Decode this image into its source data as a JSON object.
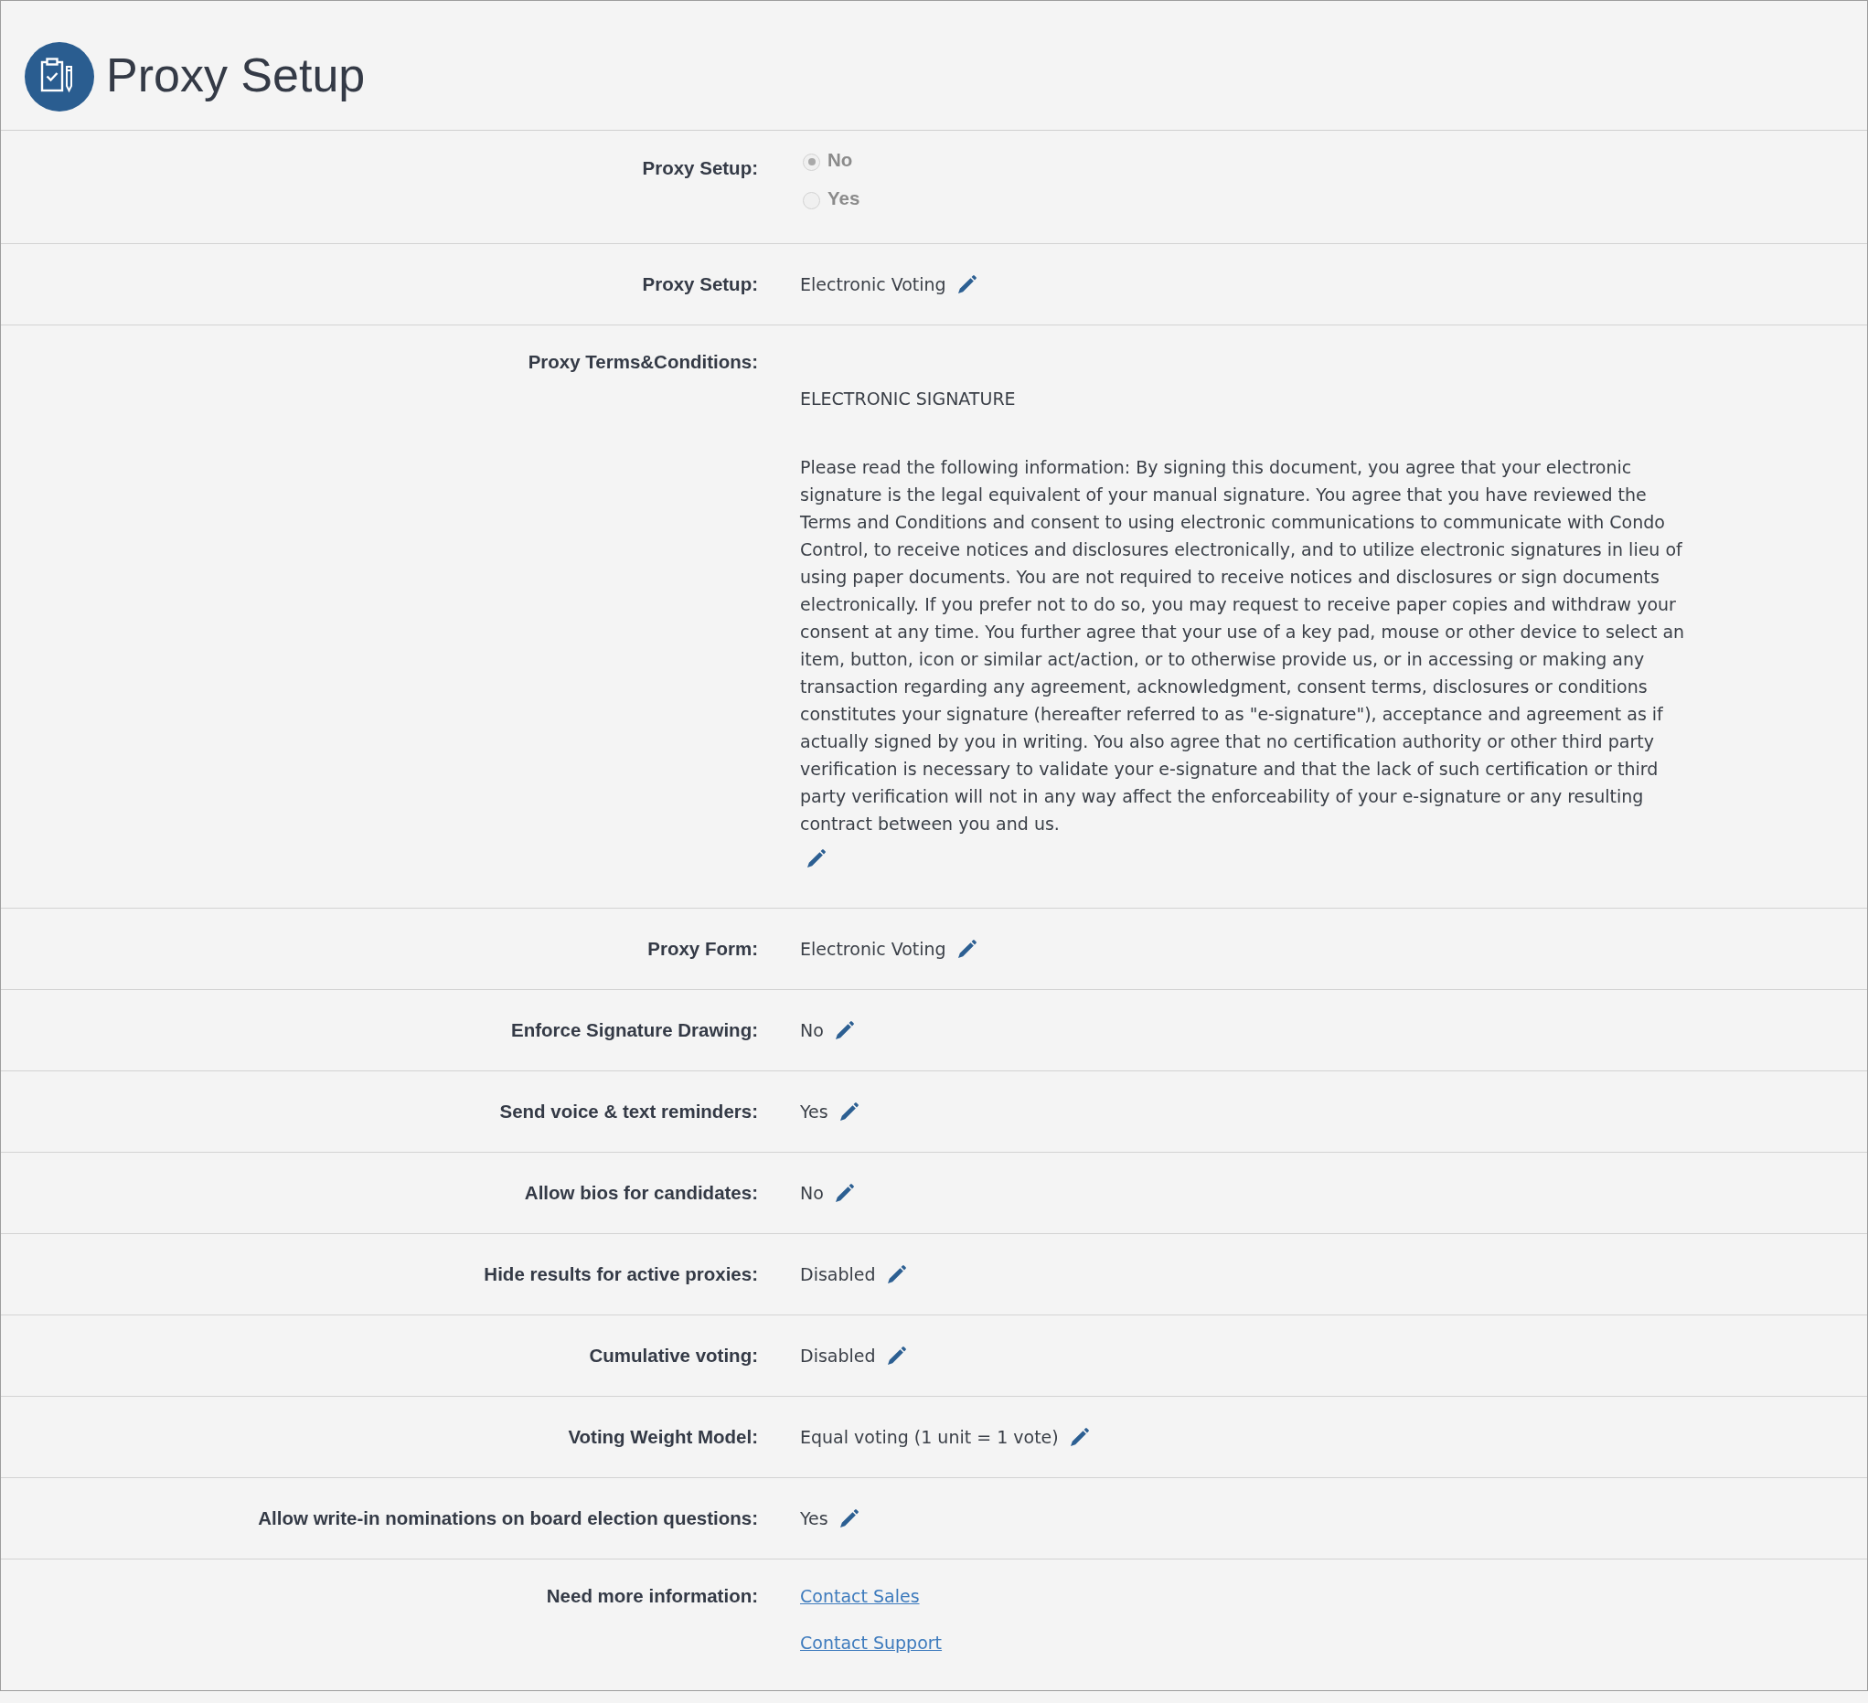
{
  "header": {
    "title": "Proxy Setup"
  },
  "rows": [
    {
      "kind": "radio",
      "label": "Proxy Setup:",
      "options": [
        {
          "label": "No",
          "selected": true,
          "disabled": true
        },
        {
          "label": "Yes",
          "selected": false,
          "disabled": true
        }
      ]
    },
    {
      "kind": "value",
      "label": "Proxy Setup:",
      "value": "Electronic Voting"
    },
    {
      "kind": "terms",
      "label": "Proxy Terms&Conditions:",
      "heading": "ELECTRONIC SIGNATURE",
      "body": "Please read the following information: By signing this document, you agree that your electronic signature is the legal equivalent of your manual signature. You agree that you have reviewed the Terms and Conditions and consent to using electronic communications to communicate with Condo Control, to receive notices and disclosures electronically, and to utilize electronic signatures in lieu of using paper documents. You are not required to receive notices and disclosures or sign documents electronically. If you prefer not to do so, you may request to receive paper copies and withdraw your consent at any time. You further agree that your use of a key pad, mouse or other device to select an item, button, icon or similar act/action, or to otherwise provide us, or in accessing or making any transaction regarding any agreement, acknowledgment, consent terms, disclosures or conditions constitutes your signature (hereafter referred to as \"e-signature\"), acceptance and agreement as if actually signed by you in writing. You also agree that no certification authority or other third party verification is necessary to validate your e-signature and that the lack of such certification or third party verification will not in any way affect the enforceability of your e-signature or any resulting contract between you and us."
    },
    {
      "kind": "value",
      "label": "Proxy Form:",
      "value": "Electronic Voting"
    },
    {
      "kind": "value",
      "label": "Enforce Signature Drawing:",
      "value": "No"
    },
    {
      "kind": "value",
      "label": "Send voice & text reminders:",
      "value": "Yes"
    },
    {
      "kind": "value",
      "label": "Allow bios for candidates:",
      "value": "No"
    },
    {
      "kind": "value",
      "label": "Hide results for active proxies:",
      "value": "Disabled"
    },
    {
      "kind": "value",
      "label": "Cumulative voting:",
      "value": "Disabled"
    },
    {
      "kind": "value",
      "label": "Voting Weight Model:",
      "value": "Equal voting (1 unit = 1 vote)"
    },
    {
      "kind": "value",
      "label": "Allow write-in nominations on board election questions:",
      "value": "Yes"
    },
    {
      "kind": "links",
      "label": "Need more information:",
      "links": [
        "Contact Sales",
        "Contact Support"
      ]
    }
  ]
}
